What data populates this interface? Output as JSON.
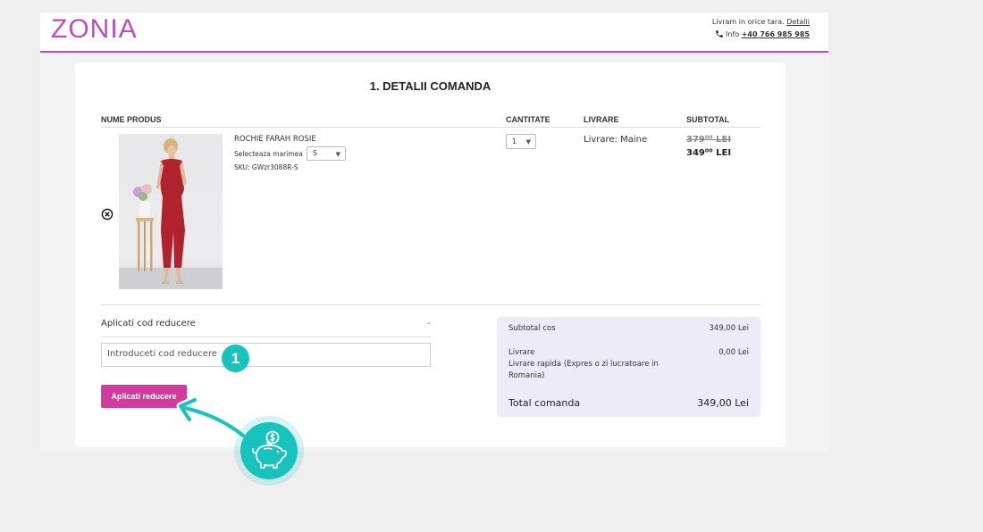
{
  "header": {
    "logo": "ZONIA",
    "shipping_text": "Livram in orice tara.",
    "details_link": "Detalii",
    "info_label": "Info",
    "phone": "+40 766 985 985"
  },
  "checkout": {
    "title": "1. DETALII COMANDA",
    "columns": {
      "product": "NUME PRODUS",
      "quantity": "CANTITATE",
      "delivery": "LIVRARE",
      "subtotal": "SUBTOTAL"
    },
    "item": {
      "name": "ROCHIE FARAH ROSIE",
      "size_label": "Selecteaza marimea",
      "size_value": "S",
      "sku": "SKU: GWzr3088R-S",
      "quantity": "1",
      "delivery": "Livrare: Maine",
      "old_price": "379⁰⁰ LEI",
      "new_price": "349⁰⁰ LEI"
    }
  },
  "coupon": {
    "label": "Aplicati cod reducere",
    "toggle": "-",
    "placeholder": "Introduceti cod reducere",
    "button": "Aplicati reducere"
  },
  "summary": {
    "subtotal_label": "Subtotal cos",
    "subtotal_value": "349,00 Lei",
    "delivery_label": "Livrare",
    "delivery_value": "0,00 Lei",
    "delivery_desc": "Livrare rapida (Expres o zi lucratoare in Romania)",
    "total_label": "Total comanda",
    "total_value": "349,00 Lei"
  },
  "annotation": {
    "step_number": "1"
  },
  "colors": {
    "brand": "#c04ac4",
    "button": "#d23a9e",
    "annotation": "#19c3bd",
    "summary_bg": "#ecebf7"
  }
}
